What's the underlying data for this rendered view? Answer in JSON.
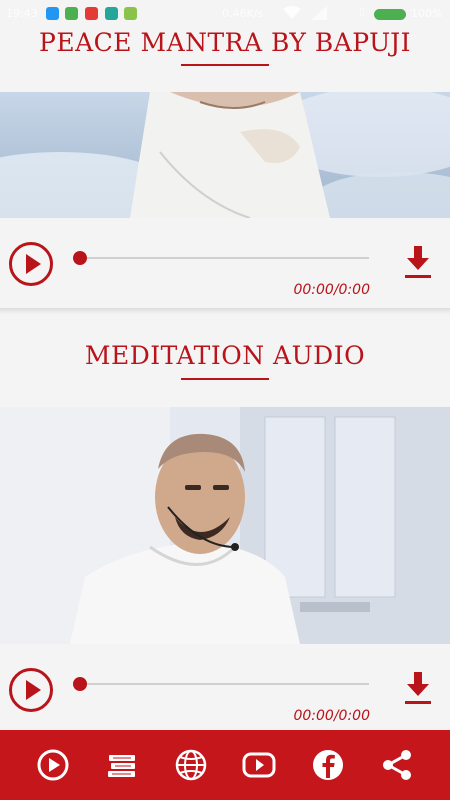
{
  "status_bar": {
    "time": "19:43",
    "network_speed": "0.46K/s",
    "battery": "100%",
    "notification_icons": [
      "usb-icon",
      "phone-icon",
      "youtube-icon",
      "play-store-icon",
      "android-icon"
    ]
  },
  "sections": [
    {
      "title": "PEACE MANTRA BY BAPUJI",
      "player": {
        "elapsed_duration": "00:00/0:00",
        "progress": 0
      }
    },
    {
      "title": "MEDITATION AUDIO",
      "player": {
        "elapsed_duration": "00:00/0:00",
        "progress": 0
      }
    }
  ],
  "bottom_nav": [
    {
      "icon": "play-icon"
    },
    {
      "icon": "books-icon"
    },
    {
      "icon": "globe-icon"
    },
    {
      "icon": "youtube-icon"
    },
    {
      "icon": "facebook-icon"
    },
    {
      "icon": "share-icon"
    }
  ],
  "colors": {
    "accent": "#b8141a",
    "bottom_bar": "#c5161c",
    "background": "#f4f4f4"
  }
}
